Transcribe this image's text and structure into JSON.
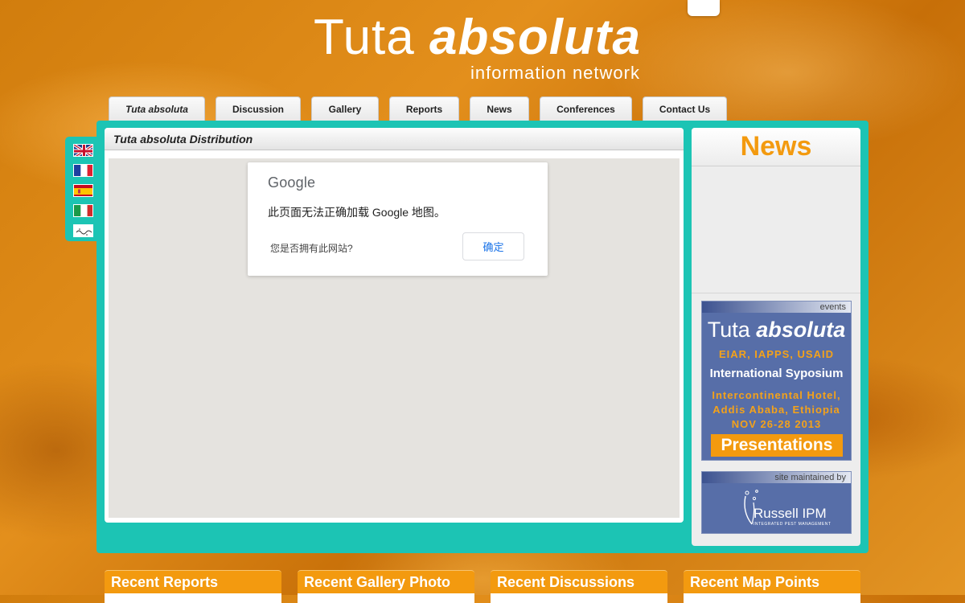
{
  "header": {
    "title_part1": "Tuta",
    "title_part2": "absoluta",
    "subtitle": "information network"
  },
  "nav": {
    "tabs": [
      {
        "label": "Tuta absoluta",
        "active": true
      },
      {
        "label": "Discussion"
      },
      {
        "label": "Gallery"
      },
      {
        "label": "Reports"
      },
      {
        "label": "News"
      },
      {
        "label": "Conferences"
      },
      {
        "label": "Contact Us"
      }
    ]
  },
  "languages": [
    "english-flag-icon",
    "french-flag-icon",
    "spanish-flag-icon",
    "italian-flag-icon",
    "arabic-flag-icon"
  ],
  "map": {
    "title": "Tuta absoluta Distribution",
    "dialog": {
      "brand": "Google",
      "message": "此页面无法正确加载 Google 地图。",
      "question": "您是否拥有此网站?",
      "ok_label": "确定"
    }
  },
  "sidebar": {
    "news_title": "News",
    "events": {
      "tag": "events",
      "title_part1": "Tuta",
      "title_part2": "absoluta",
      "sponsors": "EIAR, IAPPS, USAID",
      "event_name": "International Syposium",
      "venue_line1": "Intercontinental Hotel,",
      "venue_line2": "Addis Ababa, Ethiopia",
      "dates": "NOV 26-28 2013",
      "button_label": "Presentations"
    },
    "maintained": {
      "tag": "site maintained by",
      "company": "Russell IPM",
      "tagline": "INTEGRATED PEST MANAGEMENT"
    }
  },
  "bottom_tabs": [
    "Recent Reports",
    "Recent Gallery Photo",
    "Recent Discussions",
    "Recent Map Points"
  ],
  "colors": {
    "teal": "#1cc4b4",
    "orange": "#f39a0f",
    "navy": "#576ea8"
  }
}
